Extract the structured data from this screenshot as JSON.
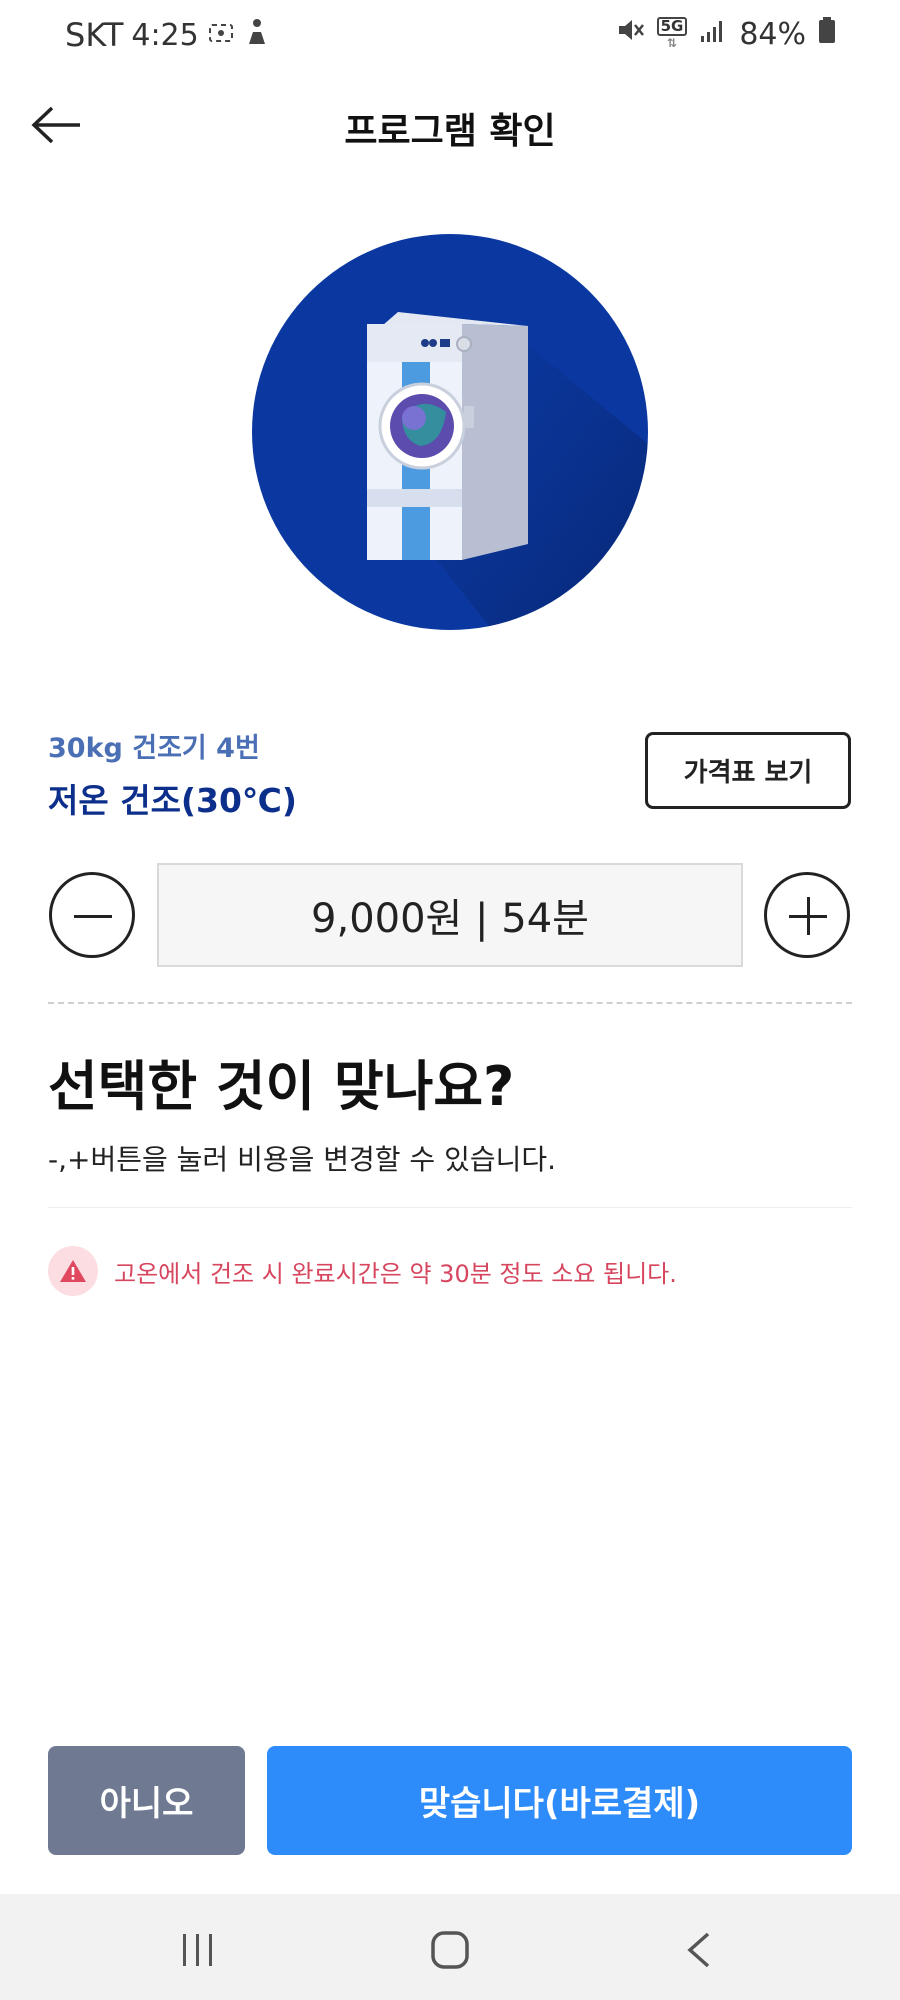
{
  "status_bar": {
    "carrier": "SKT",
    "time": "4:25",
    "network": "5G",
    "battery": "84%",
    "icons": [
      "screen-record-icon",
      "accessibility-icon",
      "mute-icon",
      "network-5g-icon",
      "signal-icon",
      "battery-icon"
    ]
  },
  "header": {
    "title": "프로그램 확인",
    "back_icon": "back-arrow-icon"
  },
  "hero": {
    "icon": "dryer-illustration",
    "circle_color": "#0b38a0"
  },
  "machine": {
    "subtitle": "30kg 건조기 4번",
    "program": "저온 건조(30℃)"
  },
  "price_table_button": "가격표 보기",
  "stepper": {
    "minus_icon": "minus-icon",
    "plus_icon": "plus-icon",
    "value": "9,000원 | 54분"
  },
  "confirm": {
    "question": "선택한 것이 맞나요?",
    "helper": "-,+버튼을 눌러 비용을 변경할 수 있습니다."
  },
  "warning": {
    "icon": "warning-icon",
    "text": "고온에서 건조 시 완료시간은 약 30분 정도 소요 됩니다.",
    "color": "#d7465f"
  },
  "actions": {
    "no_label": "아니오",
    "yes_label": "맞습니다(바로결제)",
    "no_color": "#6f7a92",
    "yes_color": "#2d8cfa"
  },
  "nav": {
    "recent_icon": "recent-apps-icon",
    "home_icon": "home-icon",
    "back_icon": "nav-back-icon"
  }
}
